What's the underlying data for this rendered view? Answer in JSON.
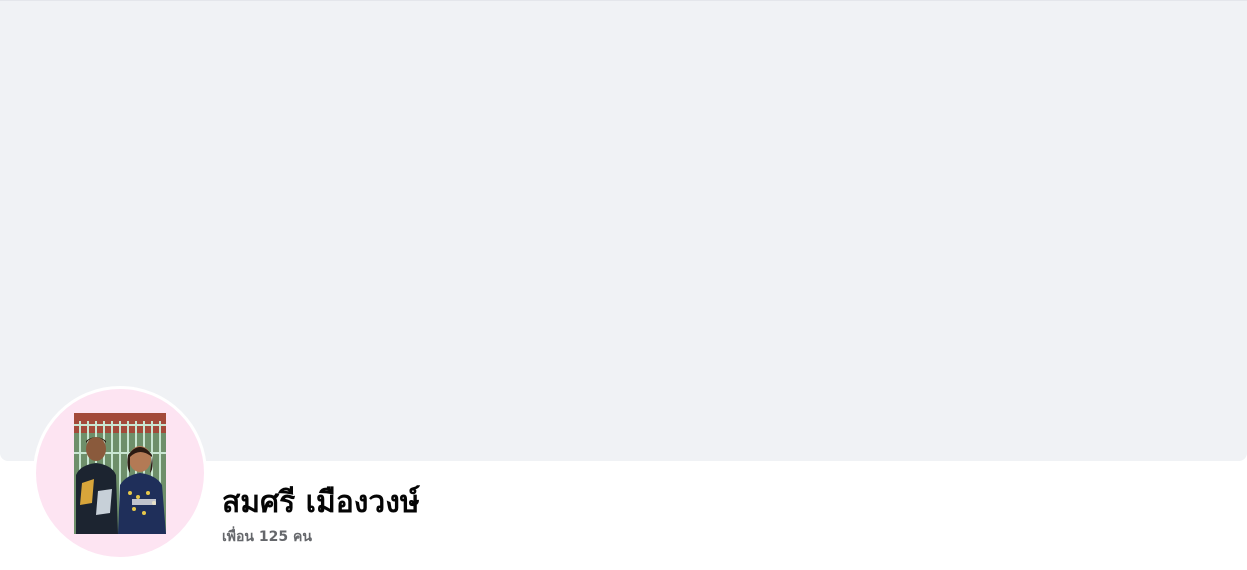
{
  "profile": {
    "name": "สมศรี เมืองวงษ์",
    "friends_text": "เพื่อน 125 คน",
    "cover_color": "#f0f2f5",
    "avatar_bg_color": "#fde4f2"
  }
}
